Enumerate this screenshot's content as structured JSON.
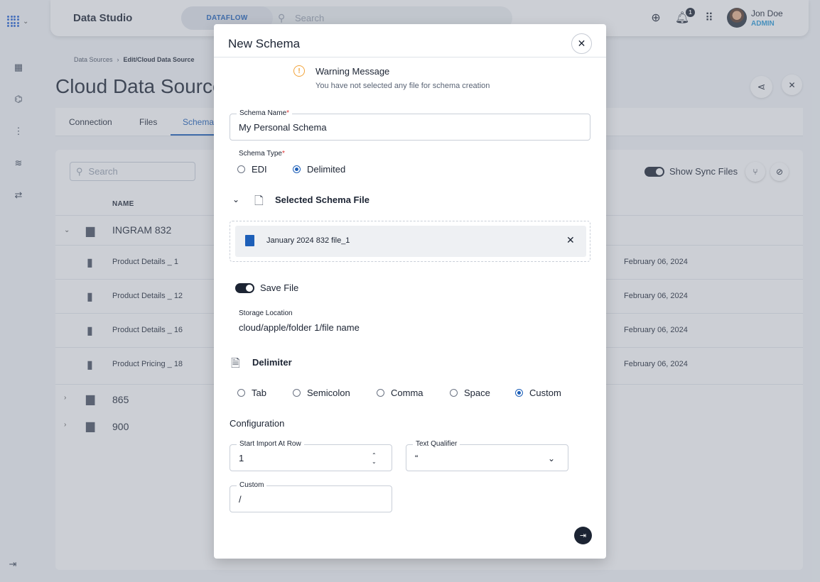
{
  "header": {
    "app_title": "Data Studio",
    "scope_label": "DATAFLOW",
    "search_placeholder": "Search",
    "notification_count": "1",
    "user_name": "Jon Doe",
    "user_role": "ADMIN"
  },
  "breadcrumb": {
    "items": [
      "Data Sources",
      "Edit/Cloud Data Source"
    ],
    "separator": "›"
  },
  "page": {
    "title": "Cloud Data Source",
    "tabs": [
      "Connection",
      "Files",
      "Schemas"
    ],
    "active_tab": "Schemas"
  },
  "list": {
    "search_placeholder": "Search",
    "show_sync_files_label": "Show Sync Files",
    "column_name": "NAME",
    "rows": [
      {
        "type": "folder",
        "name": "INGRAM 832",
        "expanded": true,
        "date": ""
      },
      {
        "type": "file",
        "name": "Product Details _ 1",
        "date": "February 06, 2024"
      },
      {
        "type": "file",
        "name": "Product Details _ 12",
        "date": "February 06, 2024"
      },
      {
        "type": "file",
        "name": "Product Details _ 16",
        "date": "February 06, 2024"
      },
      {
        "type": "file",
        "name": "Product Pricing _ 18",
        "date": "February 06, 2024"
      },
      {
        "type": "folder",
        "name": "865",
        "expanded": false,
        "date": ""
      },
      {
        "type": "folder",
        "name": "900",
        "expanded": false,
        "date": ""
      }
    ]
  },
  "modal": {
    "title": "New Schema",
    "warning_title": "Warning Message",
    "warning_text": "You have not selected any file for schema creation",
    "schema_name_label": "Schema Name",
    "schema_name_value": "My Personal Schema",
    "schema_type_label": "Schema Type",
    "schema_types": [
      "EDI",
      "Delimited"
    ],
    "schema_type_selected": "Delimited",
    "selected_file_section": "Selected Schema File",
    "selected_file_name": "January 2024 832 file_1",
    "save_file_label": "Save File",
    "save_file_on": true,
    "storage_location_label": "Storage Location",
    "storage_location_value": "cloud/apple/folder 1/file name",
    "delimiter_section": "Delimiter",
    "delimiters": [
      "Tab",
      "Semicolon",
      "Comma",
      "Space",
      "Custom"
    ],
    "delimiter_selected": "Custom",
    "configuration_title": "Configuration",
    "start_import_label": "Start Import At Row",
    "start_import_value": "1",
    "text_qualifier_label": "Text Qualifier",
    "text_qualifier_value": "“",
    "custom_label": "Custom",
    "custom_value": "/"
  },
  "colors": {
    "accent": "#1d5fb8",
    "dark": "#1c2433",
    "warning": "#f2a33a",
    "role": "#2a9ad8"
  },
  "icons": {
    "logo": "grid-dots-icon",
    "warning": "warning-circle-icon",
    "close": "close-icon",
    "next": "arrow-right-to-line-icon"
  }
}
